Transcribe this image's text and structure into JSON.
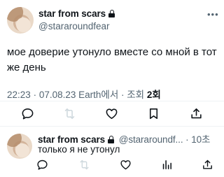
{
  "tweet": {
    "author_name": "star from scars",
    "author_handle": "@stararoundfear",
    "more_icon": "more-horizontal-icon",
    "text": "мое доверие утонуло вместе со мной в тот же день",
    "time": "22:23",
    "date": "07.08.23",
    "source": "Earth에서",
    "views_label": "조회",
    "views_count": "2회",
    "actions": [
      "reply-icon",
      "retweet-icon",
      "like-icon",
      "bookmark-icon",
      "share-icon"
    ]
  },
  "reply": {
    "author_name": "star from scars",
    "author_handle": "@stararoundf...",
    "time": "10초",
    "text": "только я не утонул",
    "actions": [
      "reply-icon",
      "retweet-icon",
      "like-icon",
      "views-icon",
      "share-icon"
    ]
  },
  "colors": {
    "text": "#0f1419",
    "secondary": "#536471",
    "divider": "#eff3f4",
    "disabled": "#cfd9de"
  }
}
